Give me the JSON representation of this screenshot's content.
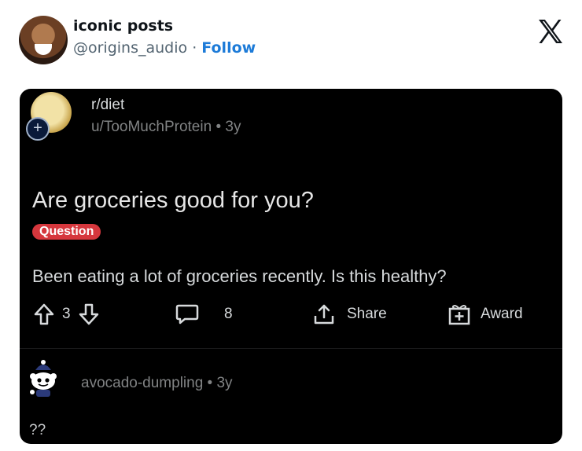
{
  "tweet": {
    "author_name": "iconic posts",
    "handle": "@origins_audio",
    "separator": "·",
    "follow_label": "Follow"
  },
  "icons": {
    "x_logo": "x-logo-icon"
  },
  "reddit_post": {
    "subreddit": "r/diet",
    "user": "u/TooMuchProtein",
    "meta_separator": "•",
    "age": "3y",
    "title": "Are groceries good for you?",
    "flair": "Question",
    "body": "Been eating a lot of groceries recently. Is this healthy?",
    "vote_count": "3",
    "comment_count": "8",
    "share_label": "Share",
    "award_label": "Award",
    "flair_color": "#d6373d"
  },
  "comment": {
    "author": "avocado-dumpling",
    "separator": "•",
    "age": "3y",
    "text": "??"
  }
}
